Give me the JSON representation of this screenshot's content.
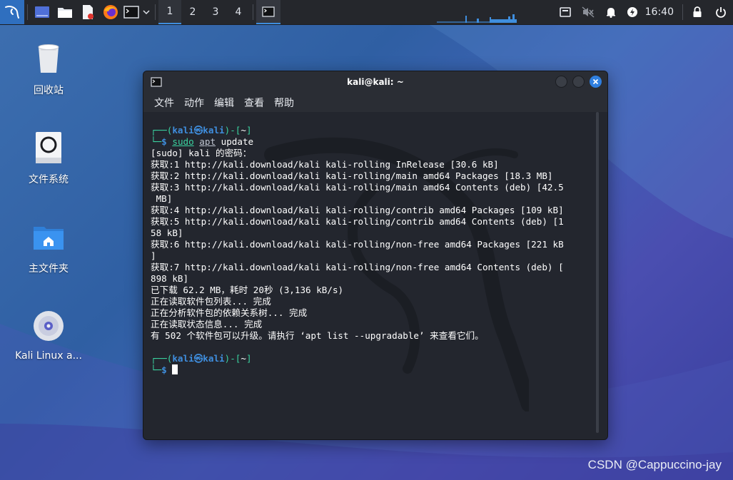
{
  "taskbar": {
    "workspaces": [
      "1",
      "2",
      "3",
      "4"
    ],
    "active_workspace": "1",
    "clock": "16:40",
    "accent": "#3f8ede"
  },
  "desktop": {
    "icons": [
      {
        "label": "回收站",
        "icon": "trash-icon"
      },
      {
        "label": "文件系统",
        "icon": "drive-icon"
      },
      {
        "label": "主文件夹",
        "icon": "home-folder-icon"
      },
      {
        "label": "Kali Linux a...",
        "icon": "disc-icon"
      }
    ]
  },
  "terminal": {
    "title": "kali@kali: ~",
    "menu": [
      "文件",
      "动作",
      "编辑",
      "查看",
      "帮助"
    ],
    "prompt": {
      "user": "kali",
      "host": "kali",
      "at": "㉿",
      "dir": "~",
      "symbol": "$"
    },
    "command": {
      "sudo": "sudo",
      "apt": "apt",
      "args": "update"
    },
    "output": [
      "[sudo] kali 的密码：",
      "获取:1 http://kali.download/kali kali-rolling InRelease [30.6 kB]",
      "获取:2 http://kali.download/kali kali-rolling/main amd64 Packages [18.3 MB]",
      "获取:3 http://kali.download/kali kali-rolling/main amd64 Contents (deb) [42.5",
      " MB]",
      "获取:4 http://kali.download/kali kali-rolling/contrib amd64 Packages [109 kB]",
      "获取:5 http://kali.download/kali kali-rolling/contrib amd64 Contents (deb) [1",
      "58 kB]",
      "获取:6 http://kali.download/kali kali-rolling/non-free amd64 Packages [221 kB",
      "]",
      "获取:7 http://kali.download/kali kali-rolling/non-free amd64 Contents (deb) [",
      "898 kB]",
      "已下载 62.2 MB，耗时 20秒 (3,136 kB/s)",
      "正在读取软件包列表... 完成",
      "正在分析软件包的依赖关系树... 完成",
      "正在读取状态信息... 完成",
      "有 502 个软件包可以升级。请执行 ‘apt list --upgradable’ 来查看它们。"
    ]
  },
  "watermark": "CSDN @Cappuccino-jay"
}
